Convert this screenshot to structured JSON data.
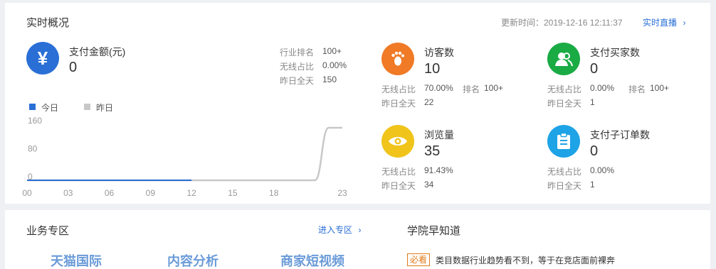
{
  "overview": {
    "title": "实时概况",
    "update_label": "更新时间：2019-12-16 12:11:37",
    "live_link": "实时直播",
    "payment": {
      "name": "支付金额(元)",
      "value": "0",
      "rank_label": "行业排名",
      "rank_value": "100+",
      "wireless_label": "无线占比",
      "wireless_value": "0.00%",
      "yesterday_label": "昨日全天",
      "yesterday_value": "150"
    },
    "visitors": {
      "name": "访客数",
      "value": "10",
      "wireless_label": "无线占比",
      "wireless_value": "70.00%",
      "rank_label": "排名",
      "rank_value": "100+",
      "yesterday_label": "昨日全天",
      "yesterday_value": "22"
    },
    "buyers": {
      "name": "支付买家数",
      "value": "0",
      "wireless_label": "无线占比",
      "wireless_value": "0.00%",
      "rank_label": "排名",
      "rank_value": "100+",
      "yesterday_label": "昨日全天",
      "yesterday_value": "1"
    },
    "pageviews": {
      "name": "浏览量",
      "value": "35",
      "wireless_label": "无线占比",
      "wireless_value": "91.43%",
      "yesterday_label": "昨日全天",
      "yesterday_value": "34"
    },
    "suborders": {
      "name": "支付子订单数",
      "value": "0",
      "wireless_label": "无线占比",
      "wireless_value": "0.00%",
      "yesterday_label": "昨日全天",
      "yesterday_value": "1"
    },
    "icons": {
      "payment": "yuan-icon",
      "visitors": "footprint-icon",
      "buyers": "users-icon",
      "pageviews": "eye-icon",
      "suborders": "clipboard-icon"
    },
    "colors": {
      "payment": "#2a6fd6",
      "visitors": "#f07a26",
      "buyers": "#1aab45",
      "pageviews": "#f0c41a",
      "suborders": "#1ea3e6"
    }
  },
  "chart_data": {
    "type": "line",
    "legend": [
      "今日",
      "昨日"
    ],
    "legend_placement": "top-left",
    "series": [
      {
        "name": "今日",
        "color": "#2a6fd6",
        "x": [
          "00",
          "03",
          "06",
          "09",
          "12"
        ],
        "values": [
          0,
          0,
          0,
          0,
          0
        ]
      },
      {
        "name": "昨日",
        "color": "#c8c8c8",
        "x": [
          "00",
          "03",
          "06",
          "09",
          "12",
          "15",
          "18",
          "21",
          "22",
          "23"
        ],
        "values": [
          0,
          0,
          0,
          0,
          0,
          0,
          0,
          0,
          150,
          150
        ]
      }
    ],
    "x_ticks": [
      "00",
      "03",
      "06",
      "09",
      "12",
      "15",
      "18",
      "23"
    ],
    "y_ticks": [
      "160",
      "80",
      "0"
    ],
    "ylim": [
      0,
      160
    ],
    "grid": false
  },
  "business": {
    "title": "业务专区",
    "enter_link": "进入专区",
    "zones": [
      "天猫国际",
      "内容分析",
      "商家短视频"
    ],
    "academy_title": "学院早知道",
    "news_tag": "必看",
    "news_text": "类目数据行业趋势看不到，等于在竞店面前裸奔"
  }
}
